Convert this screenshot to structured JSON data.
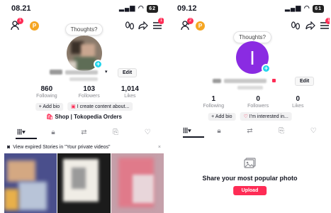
{
  "left": {
    "status": {
      "time": "08.21",
      "battery": "62"
    },
    "header": {
      "friend_badge": "1",
      "coin_label": "P",
      "menu_badge": "1"
    },
    "thoughts": "Thoughts?",
    "profile": {
      "edit_label": "Edit"
    },
    "stats": [
      {
        "value": "860",
        "label": "Following"
      },
      {
        "value": "103",
        "label": "Followers"
      },
      {
        "value": "1,014",
        "label": "Likes"
      }
    ],
    "bio": {
      "add_bio": "+ Add bio",
      "create_content": "I create content about..."
    },
    "shop": "Shop | Tokopedia Orders",
    "banner": {
      "text": "View expired Stories in \"Your private videos\"",
      "close": "×"
    }
  },
  "right": {
    "status": {
      "time": "09.12",
      "battery": "61"
    },
    "header": {
      "friend_badge": "2",
      "coin_label": "P",
      "menu_badge": "1"
    },
    "thoughts": "Thoughts?",
    "profile": {
      "avatar_letter": "I",
      "edit_label": "Edit"
    },
    "stats": [
      {
        "value": "1",
        "label": "Following"
      },
      {
        "value": "0",
        "label": "Followers"
      },
      {
        "value": "0",
        "label": "Likes"
      }
    ],
    "bio": {
      "add_bio": "+ Add bio",
      "interest": "I'm interested in..."
    },
    "empty": {
      "title": "Share your most popular photo",
      "upload": "Upload"
    }
  },
  "colors": {
    "accent": "#fe2c55",
    "cyan": "#20d5ec",
    "avatar_purple": "#8a2be2",
    "coin": "#f5a623"
  }
}
